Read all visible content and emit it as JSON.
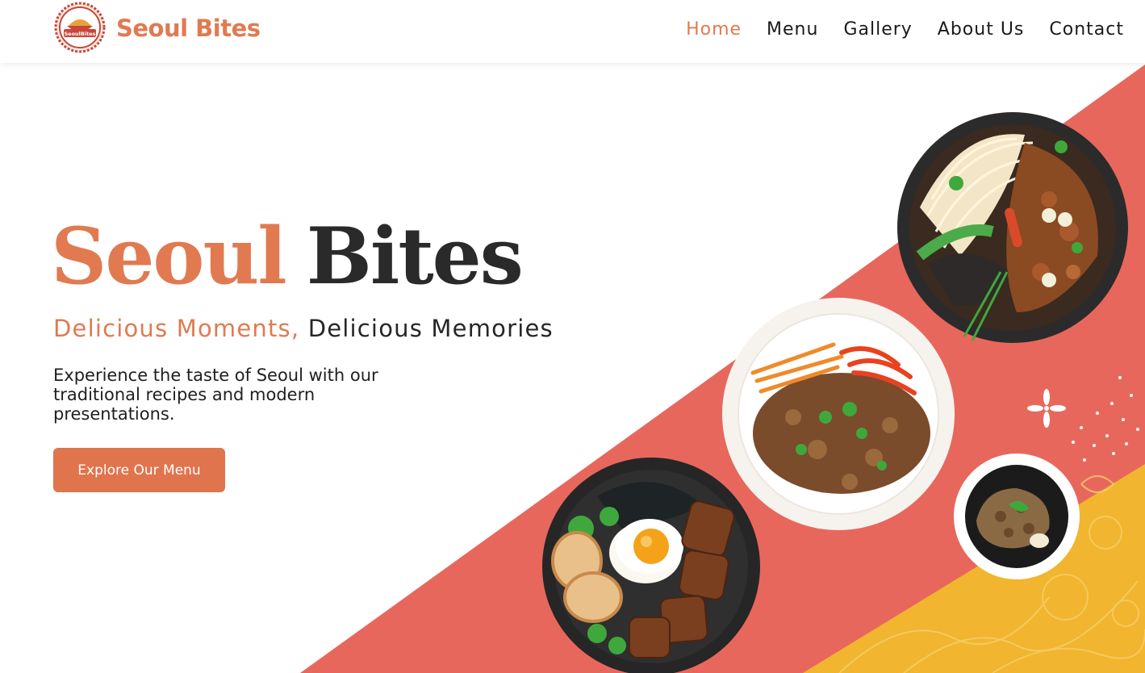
{
  "header": {
    "logo_badge_text": "SeoulBites",
    "logo_text": "Seoul Bites",
    "nav": [
      {
        "label": "Home",
        "active": true
      },
      {
        "label": "Menu",
        "active": false
      },
      {
        "label": "Gallery",
        "active": false
      },
      {
        "label": "About Us",
        "active": false
      },
      {
        "label": "Contact",
        "active": false
      }
    ]
  },
  "hero": {
    "title_word1": "Seoul",
    "title_word2": "Bites",
    "subtitle_part1": "Delicious Moments,",
    "subtitle_part2": " Delicious Memories",
    "description": "Experience the taste of Seoul with our traditional recipes and modern presentations.",
    "cta_label": "Explore Our Menu"
  },
  "colors": {
    "accent": "#e17a51",
    "dark_text": "#2a2a2a",
    "coral_band": "#e8675d",
    "yellow_band": "#f1b52f",
    "button": "#e0744d"
  },
  "decor": {
    "dishes": [
      "noodle-bowl",
      "bibimbap-plate",
      "rice-bowl-with-egg",
      "sauce-dish"
    ]
  }
}
